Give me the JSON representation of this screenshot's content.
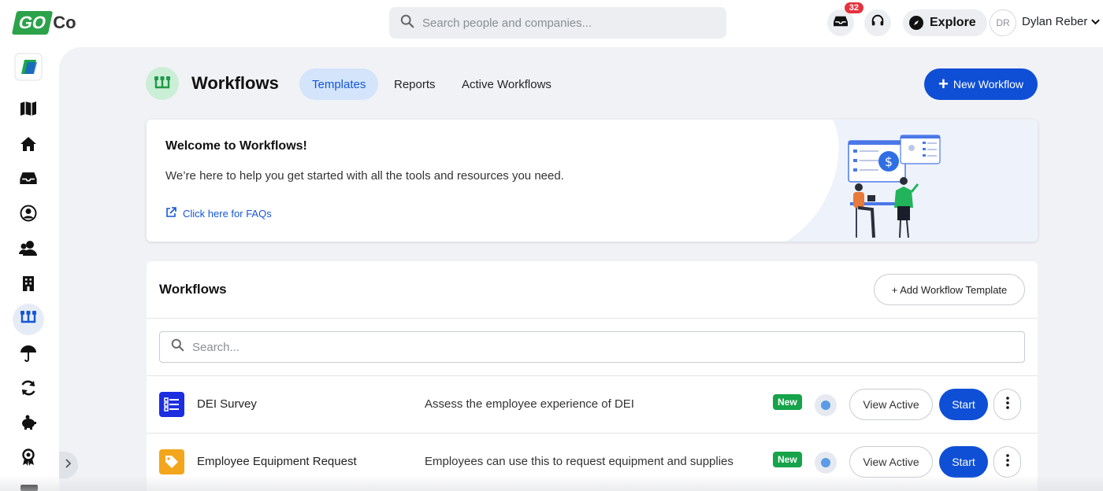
{
  "brand": {
    "logo_go": "GO",
    "logo_co": "Co",
    "accent": "#0f4fd6",
    "green": "#2ca24a"
  },
  "topbar": {
    "search_placeholder": "Search people and companies...",
    "inbox_count": "32",
    "explore_label": "Explore",
    "avatar_initials": "DR",
    "user_name": "Dylan Reber"
  },
  "sidebar": {
    "items": [
      {
        "icon": "app-launcher-icon"
      },
      {
        "icon": "map-icon"
      },
      {
        "icon": "home-icon"
      },
      {
        "icon": "inbox-icon"
      },
      {
        "icon": "user-circle-icon"
      },
      {
        "icon": "people-icon"
      },
      {
        "icon": "building-icon"
      },
      {
        "icon": "workflows-icon",
        "active": true
      },
      {
        "icon": "umbrella-icon"
      },
      {
        "icon": "sync-icon"
      },
      {
        "icon": "piggy-bank-icon"
      },
      {
        "icon": "award-icon"
      }
    ]
  },
  "header": {
    "title": "Workflows",
    "tabs": [
      {
        "label": "Templates",
        "active": true
      },
      {
        "label": "Reports",
        "active": false
      },
      {
        "label": "Active Workflows",
        "active": false
      }
    ],
    "new_button": "New Workflow"
  },
  "welcome": {
    "title": "Welcome to Workflows!",
    "body": "We’re here to help you get started with all the tools and resources you need.",
    "faq_link": "Click here for FAQs"
  },
  "workflows": {
    "title": "Workflows",
    "add_button": "+ Add Workflow Template",
    "search_placeholder": "Search...",
    "rows": [
      {
        "name": "DEI Survey",
        "description": "Assess the employee experience of DEI",
        "badge": "New",
        "icon": "list-icon",
        "icon_color": "#1b2ee0",
        "view_label": "View Active",
        "start_label": "Start"
      },
      {
        "name": "Employee Equipment Request",
        "description": "Employees can use this to request equipment and supplies",
        "badge": "New",
        "icon": "tag-icon",
        "icon_color": "#f3a51b",
        "view_label": "View Active",
        "start_label": "Start"
      }
    ]
  }
}
